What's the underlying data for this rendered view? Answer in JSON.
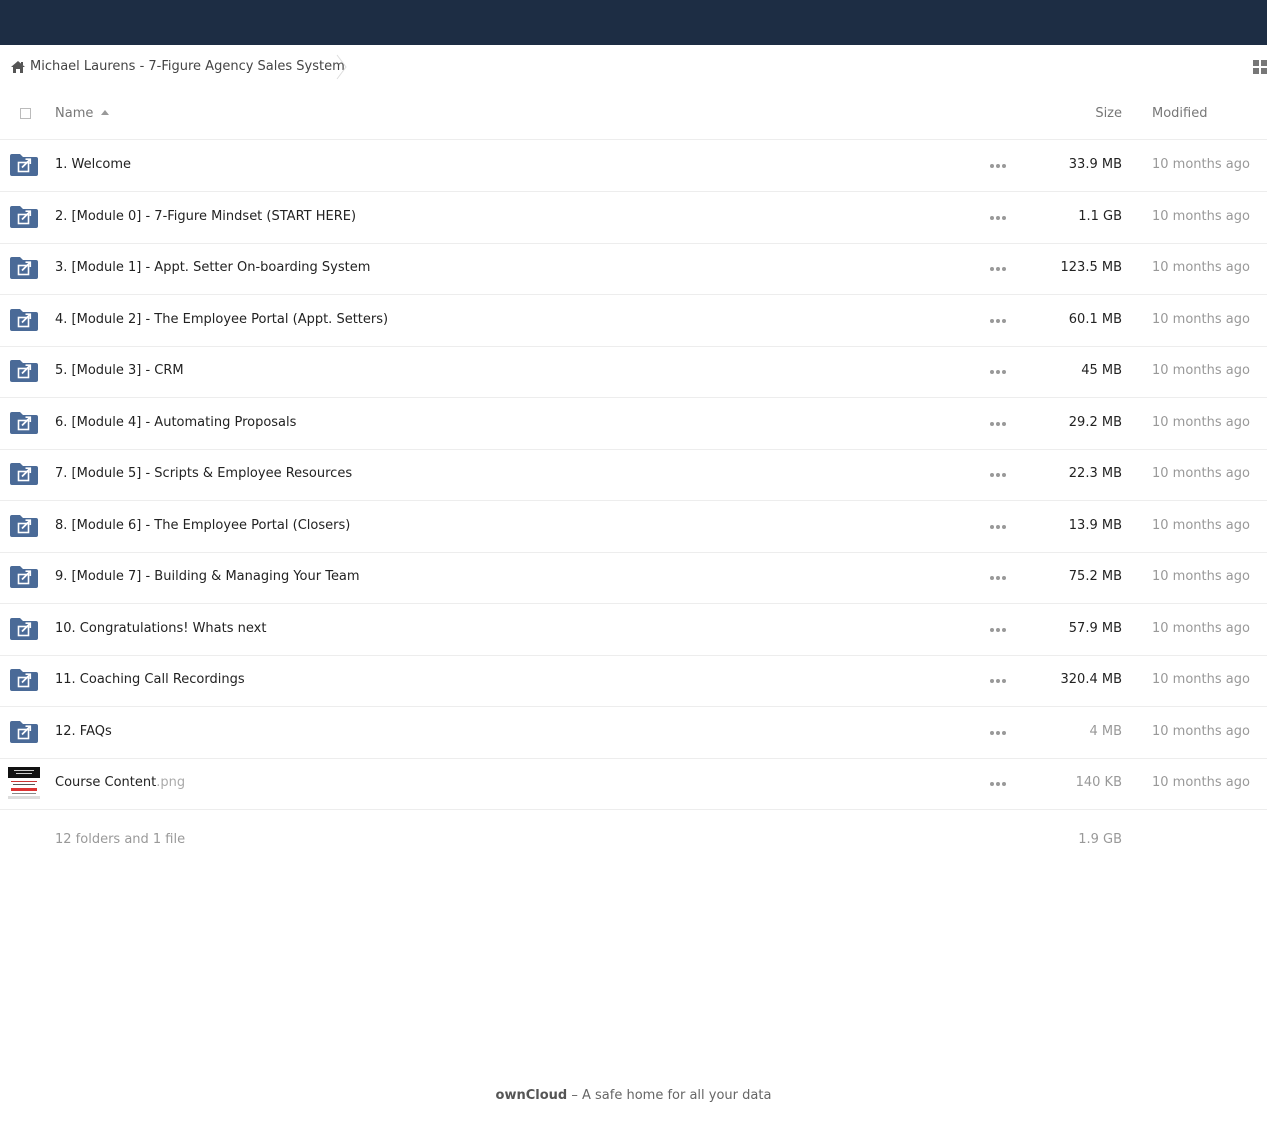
{
  "breadcrumb": {
    "home_icon": "home-icon",
    "title": "Michael Laurens - 7-Figure Agency Sales System"
  },
  "toolbar": {
    "view_toggle_icon": "grid-view-icon"
  },
  "table": {
    "headers": {
      "name": "Name",
      "size": "Size",
      "modified": "Modified"
    },
    "rows": [
      {
        "name": "1. Welcome",
        "ext": "",
        "size": "33.9 MB",
        "modified": "10 months ago",
        "type": "folder"
      },
      {
        "name": "2. [Module 0] - 7-Figure Mindset (START HERE)",
        "ext": "",
        "size": "1.1 GB",
        "modified": "10 months ago",
        "type": "folder"
      },
      {
        "name": "3. [Module 1] - Appt. Setter On-boarding System",
        "ext": "",
        "size": "123.5 MB",
        "modified": "10 months ago",
        "type": "folder"
      },
      {
        "name": "4. [Module 2] - The Employee Portal (Appt. Setters)",
        "ext": "",
        "size": "60.1 MB",
        "modified": "10 months ago",
        "type": "folder"
      },
      {
        "name": "5. [Module 3] - CRM",
        "ext": "",
        "size": "45 MB",
        "modified": "10 months ago",
        "type": "folder"
      },
      {
        "name": "6. [Module 4] - Automating Proposals",
        "ext": "",
        "size": "29.2 MB",
        "modified": "10 months ago",
        "type": "folder"
      },
      {
        "name": "7. [Module 5] - Scripts & Employee Resources",
        "ext": "",
        "size": "22.3 MB",
        "modified": "10 months ago",
        "type": "folder"
      },
      {
        "name": "8. [Module 6] - The Employee Portal (Closers)",
        "ext": "",
        "size": "13.9 MB",
        "modified": "10 months ago",
        "type": "folder"
      },
      {
        "name": "9. [Module 7] - Building & Managing Your Team",
        "ext": "",
        "size": "75.2 MB",
        "modified": "10 months ago",
        "type": "folder"
      },
      {
        "name": "10. Congratulations! Whats next",
        "ext": "",
        "size": "57.9 MB",
        "modified": "10 months ago",
        "type": "folder"
      },
      {
        "name": "11. Coaching Call Recordings",
        "ext": "",
        "size": "320.4 MB",
        "modified": "10 months ago",
        "type": "folder"
      },
      {
        "name": "12. FAQs",
        "ext": "",
        "size": "4 MB",
        "modified": "10 months ago",
        "type": "folder"
      },
      {
        "name": "Course Content",
        "ext": ".png",
        "size": "140 KB",
        "modified": "10 months ago",
        "type": "image"
      }
    ],
    "summary": {
      "count": "12 folders and 1 file",
      "total_size": "1.9 GB"
    }
  },
  "footer": {
    "brand": "ownCloud",
    "tagline": " – A safe home for all your data"
  },
  "colors": {
    "topbar": "#1d2d44",
    "folder": "#4a6a97",
    "text": "#222222",
    "muted": "#999999"
  }
}
